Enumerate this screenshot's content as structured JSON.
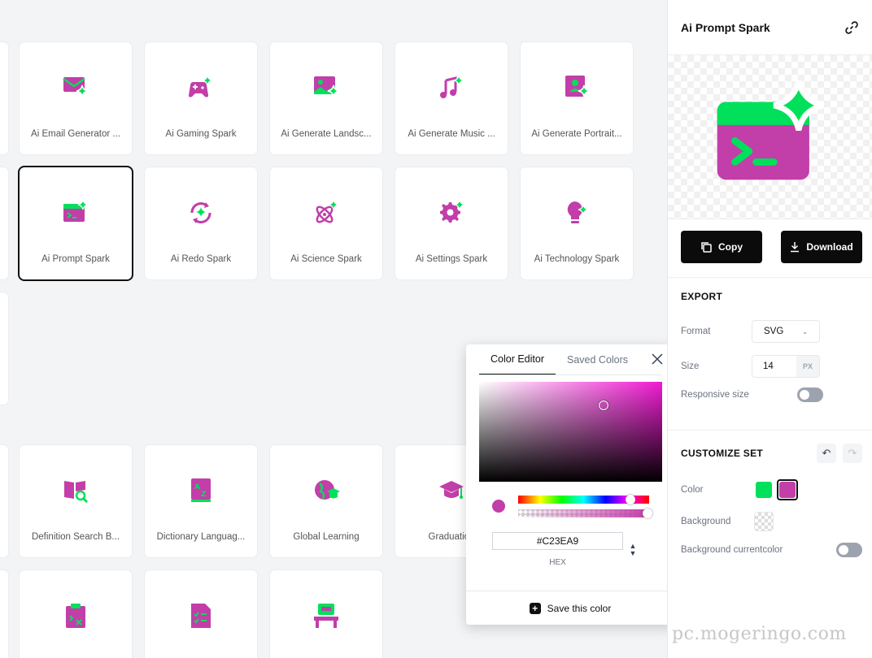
{
  "colors": {
    "primary": "#00e05a",
    "secondary": "#c23ea9",
    "hover": "#111111"
  },
  "icon_grid": {
    "row1": [
      {
        "label": "Ai Email Generator ...",
        "icon": "email-spark-icon"
      },
      {
        "label": "Ai Gaming Spark",
        "icon": "gamepad-spark-icon"
      },
      {
        "label": "Ai Generate Landsc...",
        "icon": "landscape-spark-icon"
      },
      {
        "label": "Ai Generate Music ...",
        "icon": "music-spark-icon"
      },
      {
        "label": "Ai Generate Portrait...",
        "icon": "portrait-spark-icon"
      }
    ],
    "row2": [
      {
        "label": "Ai Prompt Spark",
        "icon": "prompt-spark-icon"
      },
      {
        "label": "Ai Redo Spark",
        "icon": "redo-spark-icon"
      },
      {
        "label": "Ai Science Spark",
        "icon": "science-spark-icon"
      },
      {
        "label": "Ai Settings Spark",
        "icon": "settings-spark-icon"
      },
      {
        "label": "Ai Technology Spark",
        "icon": "technology-spark-icon"
      }
    ],
    "row3": [
      {
        "label": "Definition Search B...",
        "icon": "definition-search-icon"
      },
      {
        "label": "Dictionary Languag...",
        "icon": "dictionary-icon"
      },
      {
        "label": "Global Learning",
        "icon": "global-learning-icon"
      },
      {
        "label": "Graduation",
        "icon": "graduation-cap-icon"
      }
    ],
    "row4": [
      {
        "label": "",
        "icon": "clipboard-icon"
      },
      {
        "label": "",
        "icon": "checklist-file-icon"
      },
      {
        "label": "",
        "icon": "desk-computer-icon"
      }
    ]
  },
  "panel": {
    "title": "Ai Prompt Spark",
    "copy_label": "Copy",
    "download_label": "Download",
    "export": {
      "title": "EXPORT",
      "format_label": "Format",
      "format_value": "SVG",
      "size_label": "Size",
      "size_value": "14",
      "size_unit": "PX",
      "responsive_label": "Responsive size",
      "responsive_on": false
    },
    "customize": {
      "title": "CUSTOMIZE SET",
      "color_label": "Color",
      "background_label": "Background",
      "bg_currentcolor_label": "Background currentcolor",
      "bg_currentcolor_on": false
    }
  },
  "color_editor": {
    "tab_editor": "Color Editor",
    "tab_saved": "Saved Colors",
    "hex_value": "#C23EA9",
    "hex_label": "HEX",
    "save_label": "Save this color",
    "hue_position": 0.86,
    "alpha_position": 1.0
  },
  "watermark": "pc.mogeringo.com"
}
